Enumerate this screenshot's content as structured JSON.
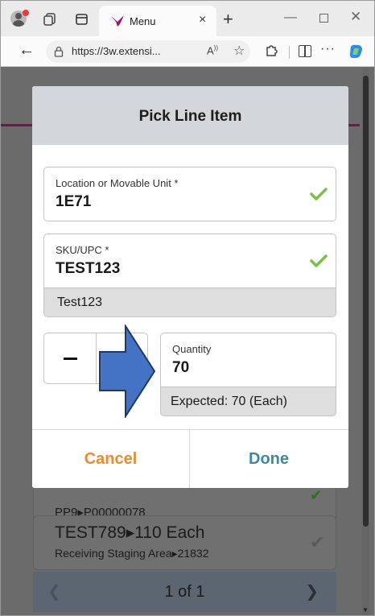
{
  "browser": {
    "tab_title": "Menu",
    "tab_close": "×",
    "new_tab": "+",
    "url": "https://3w.extensi...",
    "read_aloud": "A̵",
    "more": "···"
  },
  "modal": {
    "title": "Pick Line Item",
    "location": {
      "label": "Location or Movable Unit *",
      "value": "1E71"
    },
    "sku": {
      "label": "SKU/UPC *",
      "value": "TEST123",
      "description": "Test123"
    },
    "quantity": {
      "label": "Quantity",
      "value": "70",
      "expected": "Expected: 70 (Each)"
    },
    "cancel_label": "Cancel",
    "done_label": "Done"
  },
  "background_list": {
    "item1_line2": "PP9▸P00000078",
    "item2_line1": "TEST789▸110 Each",
    "item2_line2": "Receiving Staging Area▸21832",
    "pager_text": "1 of 1"
  },
  "colors": {
    "accent_cancel": "#ef8a2a",
    "accent_done": "#3d8a9e",
    "check_green": "#7cc142",
    "annotation_arrow": "#4472c4"
  }
}
